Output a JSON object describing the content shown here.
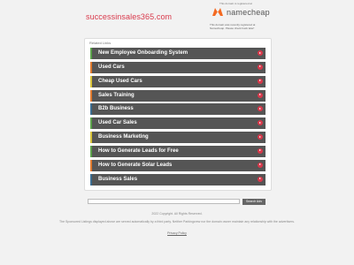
{
  "header": {
    "domain": "successinsales365.com",
    "registered_note": "This domain is registered at",
    "registrar_name": "namecheap",
    "registrar_note": "This domain was recently registered at Namecheap. Please check back later!"
  },
  "related": {
    "title": "Related Links",
    "items": [
      {
        "label": "New Employee Onboarding System",
        "accent": "#5aa04a"
      },
      {
        "label": "Used Cars",
        "accent": "#e07a2e"
      },
      {
        "label": "Cheap Used Cars",
        "accent": "#d9c43a"
      },
      {
        "label": "Sales Training",
        "accent": "#e07a2e"
      },
      {
        "label": "B2b Business",
        "accent": "#3b6c8f"
      },
      {
        "label": "Used Car Sales",
        "accent": "#5aa04a"
      },
      {
        "label": "Business Marketing",
        "accent": "#d9c43a"
      },
      {
        "label": "How to Generate Leads for Free",
        "accent": "#5aa04a"
      },
      {
        "label": "How to Generate Solar Leads",
        "accent": "#e07a2e"
      },
      {
        "label": "Business Sales",
        "accent": "#3b6c8f"
      }
    ]
  },
  "search": {
    "value": "",
    "button_label": "Search Ads"
  },
  "footer": {
    "copyright": "2022 Copyright. All Rights Reserved.",
    "disclaimer": "The Sponsored Listings displayed above are served automatically by a third party. Neither Parkingcrew nor the domain owner maintain any relationship with the advertisers.",
    "privacy": "Privacy Policy"
  },
  "colors": {
    "brand_red": "#d9394b",
    "namecheap_orange": "#f46a22",
    "item_bg": "#555555"
  }
}
